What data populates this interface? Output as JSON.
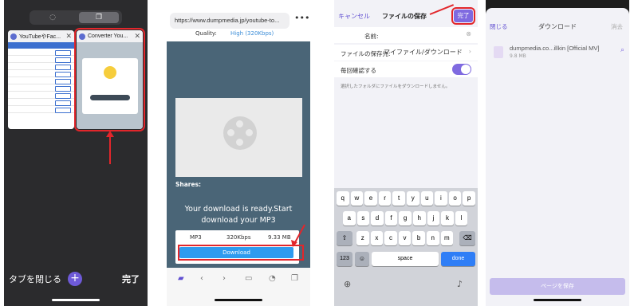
{
  "panel1": {
    "tabs": [
      {
        "title": "YouTubeやFac..."
      },
      {
        "title": "Converter You..."
      }
    ],
    "close_tabs_label": "タブを閉じる",
    "plus_label": "+",
    "done_label": "完了"
  },
  "panel2": {
    "url": "https://www.dumpmedia.jp/youtube-to...",
    "more_label": "•••",
    "quality_label": "Quality:",
    "quality_value": "High (320Kbps)",
    "shares_label": "Shares:",
    "ready_text": "Your download is ready.Start download your MP3",
    "file": {
      "format": "MP3",
      "bitrate": "320Kbps",
      "size": "9.33 MB"
    },
    "download_label": "Download"
  },
  "panel3": {
    "cancel_label": "キャンセル",
    "title": "ファイルの保存",
    "done_label": "完了",
    "name_label": "名前:",
    "location_label": "ファイルの保存先:",
    "location_value": "マイファイル/ダウンロード",
    "confirm_label": "毎回確認する",
    "confirm_hint": "選択したフォルダにファイルをダウンロードしません。",
    "keyboard": {
      "row1": [
        "q",
        "w",
        "e",
        "r",
        "t",
        "y",
        "u",
        "i",
        "o",
        "p"
      ],
      "row2": [
        "a",
        "s",
        "d",
        "f",
        "g",
        "h",
        "j",
        "k",
        "l"
      ],
      "row3": [
        "z",
        "x",
        "c",
        "v",
        "b",
        "n",
        "m"
      ],
      "num_key": "123",
      "space_key": "space",
      "done_key": "done"
    }
  },
  "panel4": {
    "close_label": "閉じる",
    "title": "ダウンロード",
    "erase_label": "消去",
    "file_name": "dumpmedia.co...illkin [Official MV]",
    "file_size": "9.8 MB",
    "save_label": "ページを保存"
  }
}
